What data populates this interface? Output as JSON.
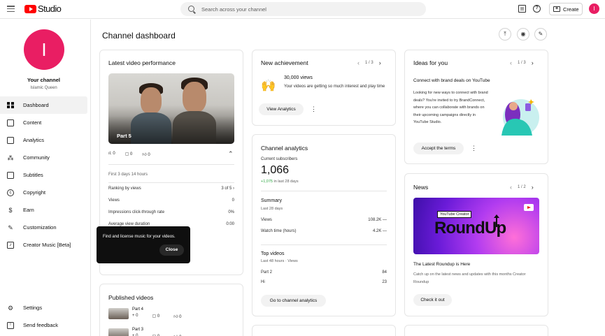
{
  "topbar": {
    "logo_text": "Studio",
    "search_placeholder": "Search across your channel",
    "create_label": "Create",
    "avatar_letter": "I"
  },
  "sidebar": {
    "avatar_letter": "I",
    "channel_title": "Your channel",
    "channel_name": "Islamic Queen",
    "items": [
      {
        "label": "Dashboard",
        "icon": "dashboard-icon",
        "active": true
      },
      {
        "label": "Content",
        "icon": "content-icon"
      },
      {
        "label": "Analytics",
        "icon": "analytics-icon"
      },
      {
        "label": "Community",
        "icon": "community-icon"
      },
      {
        "label": "Subtitles",
        "icon": "subtitles-icon"
      },
      {
        "label": "Copyright",
        "icon": "copyright-icon"
      },
      {
        "label": "Earn",
        "icon": "earn-icon"
      },
      {
        "label": "Customization",
        "icon": "customization-icon"
      },
      {
        "label": "Creator Music [Beta]",
        "icon": "creator-music-icon"
      }
    ],
    "bottom_items": [
      {
        "label": "Settings",
        "icon": "settings-icon"
      },
      {
        "label": "Send feedback",
        "icon": "feedback-icon"
      }
    ]
  },
  "page_title": "Channel dashboard",
  "latest_video": {
    "title": "Latest video performance",
    "thumb_label": "Part 5",
    "stats": {
      "views": "0",
      "comments": "0",
      "likes": "0"
    },
    "period": "First 3 days 14 hours",
    "rows": [
      {
        "label": "Ranking by views",
        "value": "3 of 5"
      },
      {
        "label": "Views",
        "value": "0"
      },
      {
        "label": "Impressions click-through rate",
        "value": "0%"
      },
      {
        "label": "Average view duration",
        "value": "0:00"
      }
    ]
  },
  "tooltip": {
    "text": "Find and license music for your videos.",
    "close_label": "Close"
  },
  "published": {
    "title": "Published videos",
    "items": [
      {
        "title": "Part 4",
        "views": "0",
        "comments": "0",
        "likes": "0"
      },
      {
        "title": "Part 3",
        "views": "0",
        "comments": "0",
        "likes": "0"
      }
    ]
  },
  "achievement": {
    "title": "New achievement",
    "pager": "1 / 3",
    "headline": "30,000 views",
    "body": "Your videos are getting so much interest and play time",
    "button": "View Analytics"
  },
  "analytics": {
    "title": "Channel analytics",
    "subs_label": "Current subscribers",
    "subs_value": "1,066",
    "delta": "+1,075",
    "delta_suffix": "in last 28 days",
    "summary_title": "Summary",
    "summary_period": "Last 28 days",
    "summary_rows": [
      {
        "label": "Views",
        "value": "108.2K",
        "trend": "—"
      },
      {
        "label": "Watch time (hours)",
        "value": "4.2K",
        "trend": "—"
      }
    ],
    "top_title": "Top videos",
    "top_period": "Last 48 hours · Views",
    "top_rows": [
      {
        "label": "Part 2",
        "value": "84"
      },
      {
        "label": "Hi",
        "value": "23"
      }
    ],
    "button": "Go to channel analytics"
  },
  "ideas": {
    "title": "Ideas for you",
    "pager": "1 / 3",
    "headline": "Connect with brand deals on YouTube",
    "body": "Looking for new ways to connect with brand deals? You're invited to try BrandConnect, where you can collaborate with brands on their upcoming campaigns directly in YouTube Studio.",
    "button": "Accept the terms"
  },
  "news": {
    "title": "News",
    "pager": "1 / 2",
    "img_tag": "YouTube Creator",
    "img_big": "RoundUp",
    "headline": "The Latest Roundup is Here",
    "body": "Catch up on the latest news and updates with this months Creator Roundup",
    "button": "Check it out"
  },
  "colors": {
    "brand": "#ff0000",
    "avatar": "#e91e63",
    "positive": "#2ba640"
  }
}
